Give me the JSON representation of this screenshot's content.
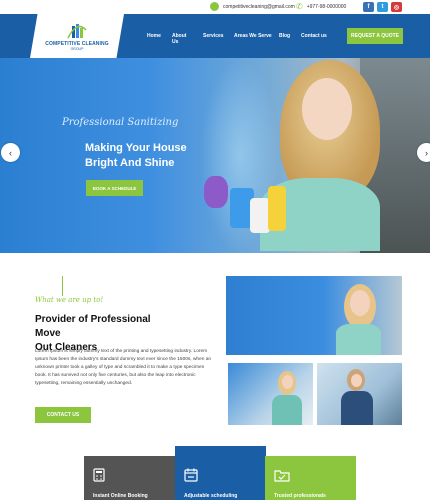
{
  "topbar": {
    "email": "competitivecleaning@gmail.com",
    "phone": "+977-98-0000000",
    "social": [
      {
        "name": "facebook",
        "glyph": "f",
        "color": "#3b6fb6"
      },
      {
        "name": "twitter",
        "glyph": "t",
        "color": "#2f9be0"
      },
      {
        "name": "instagram",
        "glyph": "◎",
        "color": "#d23b3b"
      }
    ]
  },
  "logo": {
    "name": "COMPETITIVE CLEANING",
    "sub": "GROUP"
  },
  "nav": {
    "items": [
      "Home",
      "About Us",
      "Services",
      "Areas We Serve",
      "Blog",
      "Contact us"
    ],
    "quote_button": "REQUEST A QUOTE"
  },
  "hero": {
    "tagline": "Professional Sanitizing",
    "title_line1": "Making Your House",
    "title_line2": "Bright And Shine",
    "button": "BOOK A SCHEDULE",
    "prev_arrow": "‹",
    "next_arrow": "›"
  },
  "about": {
    "tag": "What we are up to!",
    "title_line1": "Provider of Professional Move",
    "title_line2": "Out Cleaners",
    "text": "Lorem Ipsum is simply dummy text of the printing and typesetting industry. Lorem Ipsum has been the industry's standard dummy text ever since the 1500s, when an unknown printer took a galley of type and scrambled it to make a type specimen book. It has survived not only five centuries, but also the leap into electronic typesetting, remaining essentially unchanged.",
    "button": "CONTACT US"
  },
  "features": [
    {
      "label": "Instant Online Booking",
      "color": "#545454",
      "icon": "calculator-icon"
    },
    {
      "label": "Adjustable scheduling",
      "color": "#1a5fa6",
      "icon": "calendar-icon"
    },
    {
      "label": "Trusted professionals",
      "color": "#8cc63f",
      "icon": "folder-check-icon"
    }
  ],
  "colors": {
    "brand_blue": "#1a5fa6",
    "accent_green": "#8cc63f"
  }
}
